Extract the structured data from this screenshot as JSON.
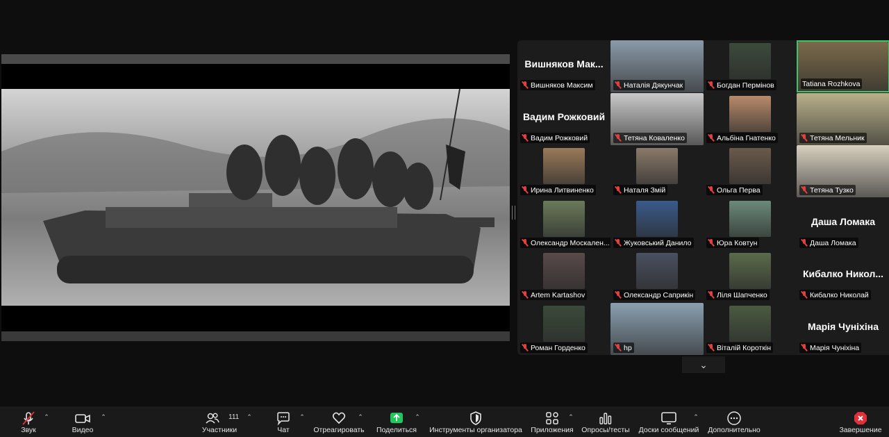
{
  "gallery": {
    "tiles": [
      {
        "name": "Вишняков Максим",
        "big": "Вишняков Мак...",
        "photo": false
      },
      {
        "name": "Наталія Дякунчак",
        "big": "",
        "photo": true,
        "color": "#8a9aa8"
      },
      {
        "name": "Богдан Пермінов",
        "big": "",
        "photo": true,
        "color": "#3b4a3a"
      },
      {
        "name": "Tatiana Rozhkova",
        "big": "",
        "photo": true,
        "color": "#7a6a4a",
        "active": true
      },
      {
        "name": "Вадим Рожковий",
        "big": "Вадим Рожковий",
        "photo": false
      },
      {
        "name": "Тетяна  Коваленко",
        "big": "",
        "photo": true,
        "color": "#c9c9c9"
      },
      {
        "name": "Альбіна Гнатенко",
        "big": "",
        "photo": true,
        "color": "#b88a6a"
      },
      {
        "name": "Тетяна Мельник",
        "big": "",
        "photo": true,
        "color": "#b9b08a"
      },
      {
        "name": "Ирина Литвиненко",
        "big": "",
        "photo": true,
        "color": "#9a7a5a"
      },
      {
        "name": "Наталя Змій",
        "big": "",
        "photo": true,
        "color": "#8a7a6a"
      },
      {
        "name": "Ольга Перва",
        "big": "",
        "photo": true,
        "color": "#6a5a4a"
      },
      {
        "name": "Тетяна Тузко",
        "big": "",
        "photo": true,
        "color": "#d8d0c0"
      },
      {
        "name": "Олександр Москален...",
        "big": "",
        "photo": true,
        "color": "#6a7a5a"
      },
      {
        "name": "Жуковський Данило",
        "big": "",
        "photo": true,
        "color": "#3a5a8a"
      },
      {
        "name": "Юра Ковтун",
        "big": "",
        "photo": true,
        "color": "#6a8a7a"
      },
      {
        "name": "Даша Ломака",
        "big": "Даша Ломака",
        "photo": false
      },
      {
        "name": "Artem Kartashov",
        "big": "",
        "photo": true,
        "color": "#5a4a4a"
      },
      {
        "name": "Олександр Саприкін",
        "big": "",
        "photo": true,
        "color": "#4a5060"
      },
      {
        "name": "Ліля Шапченко",
        "big": "",
        "photo": true,
        "color": "#5a6a4a"
      },
      {
        "name": "Кибалко Николай",
        "big": "Кибалко Никол...",
        "photo": false
      },
      {
        "name": "Роман Горденко",
        "big": "",
        "photo": true,
        "color": "#3a4a3a"
      },
      {
        "name": "hp",
        "big": "",
        "photo": true,
        "color": "#8aa0b0"
      },
      {
        "name": "Віталій Короткін",
        "big": "",
        "photo": true,
        "color": "#4a5a40"
      },
      {
        "name": "Марія Чуніхіна",
        "big": "Марія Чуніхіна",
        "photo": false
      }
    ]
  },
  "toolbar": {
    "audio": "Звук",
    "video": "Видео",
    "participants": "Участники",
    "participants_count": "111",
    "chat": "Чат",
    "react": "Отреагировать",
    "share": "Поделиться",
    "host_tools": "Инструменты организатора",
    "apps": "Приложения",
    "polls": "Опросы/тесты",
    "whiteboards": "Доски сообщений",
    "more": "Дополнительно",
    "end": "Завершение"
  },
  "colors": {
    "accent_green": "#3ec46d",
    "end_red": "#e0303a",
    "share_green": "#22c55e"
  },
  "icons": [
    "mic-muted-icon",
    "camera-icon",
    "participants-icon",
    "chat-icon",
    "heart-icon",
    "share-arrow-icon",
    "shield-icon",
    "apps-icon",
    "polls-icon",
    "whiteboard-icon",
    "more-icon",
    "end-icon",
    "chevron-down-icon"
  ]
}
